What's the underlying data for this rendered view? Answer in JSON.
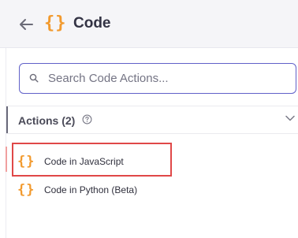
{
  "header": {
    "back_icon": "arrow-left-icon",
    "app_icon": "curly-braces-icon",
    "icon_glyph": "{}",
    "title": "Code"
  },
  "search": {
    "icon": "search-icon",
    "placeholder": "Search Code Actions...",
    "value": ""
  },
  "actions_section": {
    "title": "Actions (2)",
    "help_icon": "question-circle-icon",
    "collapse_icon": "chevron-down-icon",
    "items": [
      {
        "icon": "curly-braces-icon",
        "glyph": "{}",
        "label": "Code in JavaScript",
        "highlighted": true
      },
      {
        "icon": "curly-braces-icon",
        "glyph": "{}",
        "label": "Code in Python (Beta)",
        "highlighted": false
      }
    ]
  },
  "colors": {
    "accent_orange": "#f29a2e",
    "search_border": "#6060c8",
    "highlight_red": "#e04848",
    "header_bg": "#f5f5f8"
  }
}
